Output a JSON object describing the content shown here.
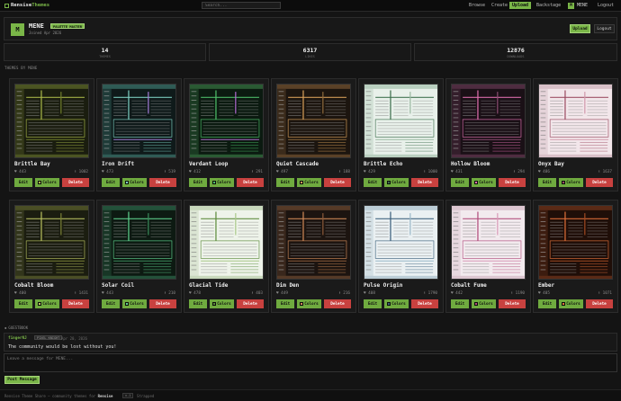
{
  "nav": {
    "brand_prefix": "Rensise",
    "brand_accent": "Themes",
    "search_placeholder": "Search...",
    "links": [
      "Browse",
      "Create",
      "Upload",
      "Backstage"
    ],
    "active": "Upload",
    "user_initial": "M",
    "user": "MENE",
    "logout": "Logout"
  },
  "profile": {
    "initial": "M",
    "name": "MENE",
    "badge": "PALETTE MASTER",
    "joined": "Joined Apr 2026",
    "upload_label": "Upload",
    "logout_label": "Logout"
  },
  "stats": [
    {
      "value": "14",
      "label": "THEMES"
    },
    {
      "value": "6317",
      "label": "LIKES"
    },
    {
      "value": "12876",
      "label": "DOWNLOADS"
    }
  ],
  "section_title": "THEMES BY MENE",
  "buttons": {
    "edit": "Edit",
    "colors": "Colors",
    "delete": "Delete"
  },
  "themes": [
    {
      "name": "Brittle Bay",
      "likes": "♥ 443",
      "downloads": "⬇ 1002",
      "bg": "#1a1d0f",
      "accent": "#a9b849",
      "accent2": "#6f7d2c",
      "line": "#4b5422"
    },
    {
      "name": "Iron Drift",
      "likes": "♥ 473",
      "downloads": "⬇ 519",
      "bg": "#0f1a1a",
      "accent": "#7ed0c2",
      "accent2": "#a27cd6",
      "line": "#2f5b55"
    },
    {
      "name": "Verdant Loop",
      "likes": "♥ 412",
      "downloads": "⬇ 291",
      "bg": "#0b1a10",
      "accent": "#4fc06a",
      "accent2": "#b06ad0",
      "line": "#2a5a33"
    },
    {
      "name": "Quiet Cascade",
      "likes": "♥ 497",
      "downloads": "⬇ 188",
      "bg": "#1c150f",
      "accent": "#d9a05a",
      "accent2": "#8e6a3c",
      "line": "#5a4127"
    },
    {
      "name": "Brittle Echo",
      "likes": "♥ 429",
      "downloads": "⬇ 1000",
      "bg": "#e8f0ea",
      "accent": "#3c6e4c",
      "accent2": "#9bb8a2",
      "line": "#b9cfbf"
    },
    {
      "name": "Hollow Bloom",
      "likes": "♥ 431",
      "downloads": "⬇ 294",
      "bg": "#1a1016",
      "accent": "#e070b0",
      "accent2": "#8a4c70",
      "line": "#4e2c40"
    },
    {
      "name": "Onyx Bay",
      "likes": "♥ 486",
      "downloads": "⬇ 1637",
      "bg": "#f2e6ea",
      "accent": "#9a4a60",
      "accent2": "#d19aac",
      "line": "#d8c0c8"
    },
    {
      "name": "Cobalt Bloom",
      "likes": "♥ 400",
      "downloads": "⬇ 1431",
      "bg": "#1b1d10",
      "accent": "#b8c060",
      "accent2": "#7a8036",
      "line": "#4a4e25"
    },
    {
      "name": "Solar Coil",
      "likes": "♥ 443",
      "downloads": "⬇ 210",
      "bg": "#0d1a12",
      "accent": "#5fd28e",
      "accent2": "#3a8a5a",
      "line": "#23513a"
    },
    {
      "name": "Glacial Tide",
      "likes": "♥ 478",
      "downloads": "⬇ 403",
      "bg": "#eef3ea",
      "accent": "#5a8a3a",
      "accent2": "#a8c88a",
      "line": "#c8d8bc"
    },
    {
      "name": "Dim Den",
      "likes": "♥ 449",
      "downloads": "⬇ 216",
      "bg": "#1c1410",
      "accent": "#d08a58",
      "accent2": "#8a5a3a",
      "line": "#553a27"
    },
    {
      "name": "Pulse Origin",
      "likes": "♥ 408",
      "downloads": "⬇ 1790",
      "bg": "#eaf0f2",
      "accent": "#3a5e7a",
      "accent2": "#9ab8c8",
      "line": "#bccdd6"
    },
    {
      "name": "Cobalt Fume",
      "likes": "♥ 442",
      "downloads": "⬇ 1190",
      "bg": "#f2eaee",
      "accent": "#b04a7a",
      "accent2": "#d99ab8",
      "line": "#dcc6d0"
    },
    {
      "name": "Ember",
      "likes": "♥ 405",
      "downloads": "⬇ 1071",
      "bg": "#1f0e08",
      "accent": "#e0703a",
      "accent2": "#a04a22",
      "line": "#5a2a16"
    }
  ],
  "guestbook": {
    "title": "GUESTBOOK",
    "author": "fingerNJ",
    "author_badge": "PIXEL KNIGHT",
    "date": "Apr 20, 2026",
    "message": "The community would be lost without you!",
    "placeholder": "Leave a message for MENE...",
    "post_label": "Post Message"
  },
  "footer": {
    "prefix": "Rensise Theme Share — community themes for ",
    "app": "Rensise",
    "version": "v.1",
    "suffix": "Strapped"
  }
}
